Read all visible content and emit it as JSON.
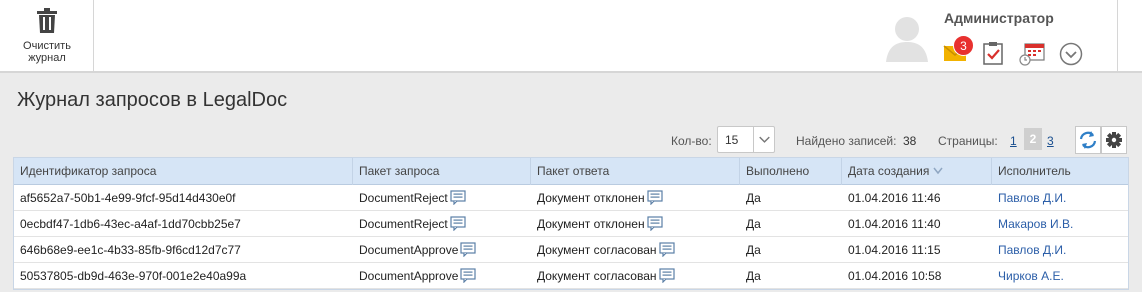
{
  "toolbar": {
    "clear_label_line1": "Очистить",
    "clear_label_line2": "журнал"
  },
  "user": {
    "name": "Администратор",
    "unread_count": "3"
  },
  "page": {
    "title": "Журнал запросов в LegalDoc"
  },
  "pager": {
    "count_label": "Кол-во:",
    "count_value": "15",
    "found_label": "Найдено записей:",
    "found_value": "38",
    "pages_label": "Страницы:",
    "pages": [
      "1",
      "2",
      "3"
    ],
    "current_page": "2"
  },
  "table": {
    "columns": [
      "Идентификатор запроса",
      "Пакет запроса",
      "Пакет ответа",
      "Выполнено",
      "Дата создания",
      "Исполнитель"
    ],
    "sorted_column": "Дата создания",
    "rows": [
      {
        "id": "af5652a7-50b1-4e99-9fcf-95d14d430e0f",
        "request": "DocumentReject",
        "response": "Документ отклонен",
        "done": "Да",
        "created": "01.04.2016 11:46",
        "user": "Павлов Д.И."
      },
      {
        "id": "0ecbdf47-1db6-43ec-a4af-1dd70cbb25e7",
        "request": "DocumentReject",
        "response": "Документ отклонен",
        "done": "Да",
        "created": "01.04.2016 11:40",
        "user": "Макаров И.В."
      },
      {
        "id": "646b68e9-ee1c-4b33-85fb-9f6cd12d7c77",
        "request": "DocumentApprove",
        "response": "Документ согласован",
        "done": "Да",
        "created": "01.04.2016 11:15",
        "user": "Павлов Д.И."
      },
      {
        "id": "50537805-db9d-463e-970f-001e2e40a99a",
        "request": "DocumentApprove",
        "response": "Документ согласован",
        "done": "Да",
        "created": "01.04.2016 10:58",
        "user": "Чирков А.Е."
      }
    ]
  },
  "colors": {
    "header_bg": "#d6e5f6",
    "badge": "#e8312f",
    "link": "#2b5ea8",
    "mail_icon": "#f2b200",
    "accent_red": "#d9302c"
  }
}
